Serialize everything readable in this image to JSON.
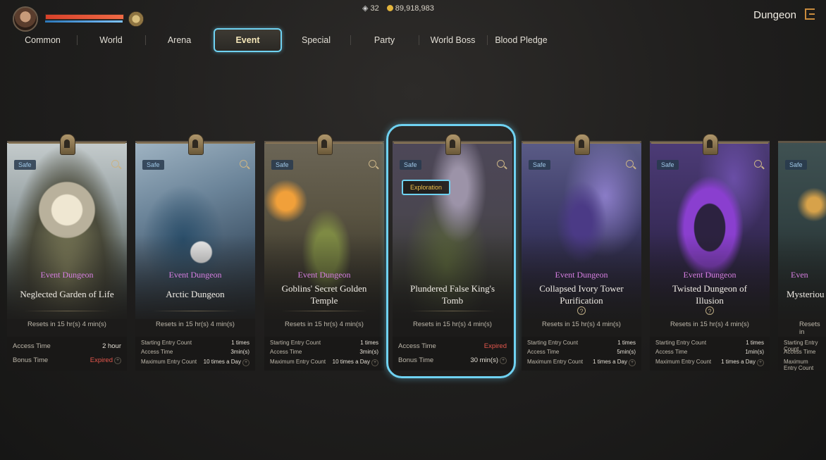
{
  "hud": {
    "eye_count": "32",
    "gold": "89,918,983",
    "screen_title": "Dungeon"
  },
  "tabs": [
    {
      "label": "Common"
    },
    {
      "label": "World"
    },
    {
      "label": "Arena"
    },
    {
      "label": "Event",
      "active": true
    },
    {
      "label": "Special"
    },
    {
      "label": "Party"
    },
    {
      "label": "World Boss"
    },
    {
      "label": "Blood Pledge"
    }
  ],
  "cards": [
    {
      "badge": "Safe",
      "type": "Event Dungeon",
      "name_lines": [
        "Neglected Garden of Life"
      ],
      "reset": "Resets in 15 hr(s) 4 min(s)",
      "access_label": "Access Time",
      "access_value": "2 hour",
      "bonus_label": "Bonus Time",
      "bonus_value": "Expired"
    },
    {
      "badge": "Safe",
      "type": "Event Dungeon",
      "name_lines": [
        "Arctic Dungeon"
      ],
      "reset": "Resets in 15 hr(s) 4 min(s)",
      "start_label": "Starting Entry Count",
      "start_value": "1 times",
      "access_label": "Access Time",
      "access_value": "3min(s)",
      "max_label": "Maximum Entry Count",
      "max_value": "10 times a Day"
    },
    {
      "badge": "Safe",
      "type": "Event Dungeon",
      "name_lines": [
        "Goblins' Secret Golden",
        "Temple"
      ],
      "reset": "Resets in 15 hr(s) 4 min(s)",
      "start_label": "Starting Entry Count",
      "start_value": "1 times",
      "access_label": "Access Time",
      "access_value": "3min(s)",
      "max_label": "Maximum Entry Count",
      "max_value": "10 times a Day"
    },
    {
      "badge": "Safe",
      "tag": "Exploration",
      "name_lines": [
        "Plundered False King's",
        "Tomb"
      ],
      "reset": "Resets in 15 hr(s) 4 min(s)",
      "access_label": "Access Time",
      "access_value": "Expired",
      "bonus_label": "Bonus Time",
      "bonus_value": "30 min(s)"
    },
    {
      "badge": "Safe",
      "type": "Event Dungeon",
      "name_lines": [
        "Collapsed Ivory Tower",
        "Purification"
      ],
      "reset": "Resets in 15 hr(s) 4 min(s)",
      "start_label": "Starting Entry Count",
      "start_value": "1 times",
      "access_label": "Access Time",
      "access_value": "5min(s)",
      "max_label": "Maximum Entry Count",
      "max_value": "1 times a Day"
    },
    {
      "badge": "Safe",
      "type": "Event Dungeon",
      "name_lines": [
        "Twisted Dungeon of",
        "Illusion"
      ],
      "reset": "Resets in 15 hr(s) 4 min(s)",
      "start_label": "Starting Entry Count",
      "start_value": "1 times",
      "access_label": "Access Time",
      "access_value": "1min(s)",
      "max_label": "Maximum Entry Count",
      "max_value": "1 times a Day"
    },
    {
      "badge": "Safe",
      "type": "Even",
      "name_lines": [
        "Mysteriou"
      ],
      "reset": "Resets in",
      "start_label": "Starting Entry Count",
      "access_label": "Access Time",
      "max_label": "Maximum Entry Count"
    }
  ]
}
